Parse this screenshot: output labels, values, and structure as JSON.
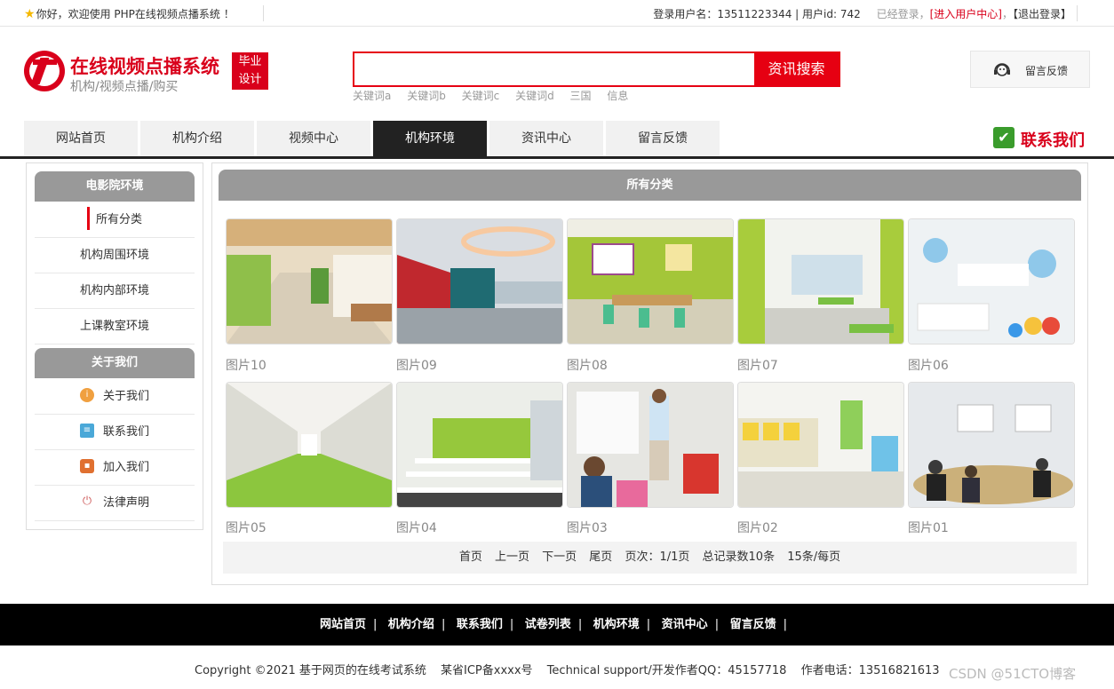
{
  "topbar": {
    "welcome": "你好，欢迎使用 PHP在线视频点播系统 ！",
    "login_label": "登录用户名：13511223344 | 用户id: 742",
    "logged_in": "已经登录，",
    "user_center": "[进入用户中心]",
    "comma": "，",
    "logout": "【退出登录】"
  },
  "logo": {
    "title": "在线视频点播系统",
    "subtitle": "机构/视频点播/购买",
    "badge_line1": "毕业",
    "badge_line2": "设计"
  },
  "search": {
    "placeholder": "",
    "button": "资讯搜索",
    "keywords": [
      "关键词a",
      "关键词b",
      "关键词c",
      "关键词d",
      "三国",
      "信息"
    ]
  },
  "feedback": {
    "label": "留言反馈",
    "icon": "customer-service-icon"
  },
  "nav": {
    "items": [
      "网站首页",
      "机构介绍",
      "视频中心",
      "机构环境",
      "资讯中心",
      "留言反馈"
    ],
    "active_index": 3
  },
  "contact": {
    "label": "联系我们",
    "icon": "check-icon"
  },
  "sidebar": {
    "group1_title": "电影院环境",
    "group1_items": [
      "所有分类",
      "机构周围环境",
      "机构内部环境",
      "上课教室环境"
    ],
    "group2_title": "关于我们",
    "group2_items": [
      {
        "label": "关于我们",
        "icon": "info-icon",
        "color": "#f0a040"
      },
      {
        "label": "联系我们",
        "icon": "document-icon",
        "color": "#4aa8d8"
      },
      {
        "label": "加入我们",
        "icon": "lock-icon",
        "color": "#e07030"
      },
      {
        "label": "法律声明",
        "icon": "power-icon",
        "color": "#d06060"
      }
    ]
  },
  "main": {
    "title": "所有分类",
    "gallery": [
      "图片10",
      "图片09",
      "图片08",
      "图片07",
      "图片06",
      "图片05",
      "图片04",
      "图片03",
      "图片02",
      "图片01"
    ]
  },
  "pager": {
    "first": "首页",
    "prev": "上一页",
    "next": "下一页",
    "last": "尾页",
    "page_info": "页次：1/1页",
    "total": "总记录数10条",
    "per_page": "15条/每页"
  },
  "footer": {
    "links": [
      "网站首页",
      "机构介绍",
      "联系我们",
      "试卷列表",
      "机构环境",
      "资讯中心",
      "留言反馈"
    ],
    "copyright": "Copyright ©2021 基于网页的在线考试系统",
    "icp": "某省ICP备xxxx号",
    "support": "Technical support/开发作者QQ：45157718",
    "phone": "作者电话：13516821613"
  },
  "watermark": "CSDN @51CTO博客",
  "colors": {
    "brand": "#d9001b",
    "accent": "#e60012",
    "nav_active": "#222222",
    "header_gray": "#999999"
  }
}
